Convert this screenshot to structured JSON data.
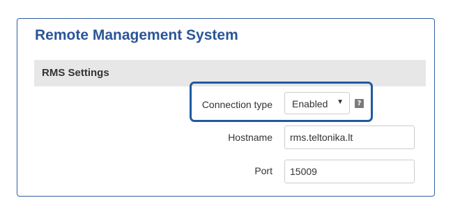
{
  "panel": {
    "title": "Remote Management System"
  },
  "section": {
    "title": "RMS Settings"
  },
  "fields": {
    "connection_type": {
      "label": "Connection type",
      "value": "Enabled",
      "caret": "▼",
      "help_icon": "?"
    },
    "hostname": {
      "label": "Hostname",
      "value": "rms.teltonika.lt"
    },
    "port": {
      "label": "Port",
      "value": "15009"
    }
  },
  "colors": {
    "accent": "#2b5597",
    "highlight_border": "#1e5aa0",
    "section_bg": "#e7e7e7"
  },
  "icons": {
    "help": "help-icon",
    "dropdown": "chevron-down-icon"
  }
}
